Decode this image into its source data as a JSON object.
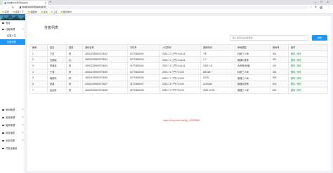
{
  "browser": {
    "tab_title": "localhost:8080/query",
    "url": "localhost:8080/queryList"
  },
  "bookmarks": [
    "应用",
    "百度一下",
    "收藏夹",
    "读书",
    "工具",
    "图片素材"
  ],
  "sidebar": {
    "items": [
      {
        "label": "首页",
        "icon": "home-icon",
        "type": "item"
      },
      {
        "label": "住客管理",
        "icon": "user-icon",
        "type": "group"
      },
      {
        "label": "住客入住",
        "type": "sub",
        "active": false
      },
      {
        "label": "住客列表",
        "type": "sub",
        "active": true
      },
      {
        "label": "房间管理",
        "icon": "room-icon",
        "type": "group"
      },
      {
        "label": "收费管理",
        "icon": "money-icon",
        "type": "group"
      },
      {
        "label": "客房管理",
        "icon": "bed-icon",
        "type": "group"
      },
      {
        "label": "财务报表",
        "icon": "chart-icon",
        "type": "group"
      },
      {
        "label": "系统设置",
        "icon": "gear-icon",
        "type": "group"
      },
      {
        "label": "开发者使用",
        "icon": "code-icon",
        "type": "item"
      }
    ]
  },
  "main": {
    "title": "住客列表",
    "search": {
      "placeholder": "输入身份证后6位查询",
      "button": "搜索"
    },
    "table": {
      "columns": [
        "编号",
        "姓名",
        "性别",
        "身份证号",
        "手机号",
        "入住时间",
        "退房时间",
        "房间类型",
        "房间号",
        "操作"
      ],
      "rows": [
        [
          "1",
          "王白",
          "男",
          "420022199507075022",
          "15773602002",
          "2020-7-3 上午10:41:41",
          "7天",
          "标准三人间",
          "301"
        ],
        [
          "2",
          "白婉瑶",
          "女",
          "420022199507075023",
          "15773602003",
          "2020-7-4 上午10:41:41",
          "7-7",
          "普通大床房",
          "307"
        ],
        [
          "3",
          "李逍遥",
          "男",
          "420022199507075024",
          "15773602004",
          "2020-7-5 上午10:41:41",
          "2020-7-8",
          "大床房(标准)",
          "401"
        ],
        [
          "4",
          "王海",
          "男",
          "420022199507075025",
          "15773602005",
          "2020-7-6 下午7:01:00",
          "ABC467",
          "标准三人间",
          "402"
        ],
        [
          "5",
          "韩露晴",
          "男",
          "420022199507075026",
          "15773602006",
          "2020-7-7 下午7:01:00",
          "22222",
          "普通三人间",
          "500"
        ],
        [
          "6",
          "张翼",
          "男",
          "420022199507075027",
          "15773602007",
          "2020-7-8 下午7:01:00",
          "22:55:58",
          "普通大床房",
          "501"
        ],
        [
          "7",
          "孟运龄",
          "男",
          "420022199507075028",
          "15773602008",
          "2020-7-9 下午7:01:00",
          "2020-12-00",
          "普通三人间",
          "502"
        ]
      ],
      "actions": {
        "delete": "删除",
        "edit": "修改"
      }
    }
  },
  "watermark": "https://blog.csdn.net/qq_44491836",
  "colors": {
    "accent": "#2196f3",
    "action_link": "#1a9e50",
    "watermark": "#e8443a"
  }
}
